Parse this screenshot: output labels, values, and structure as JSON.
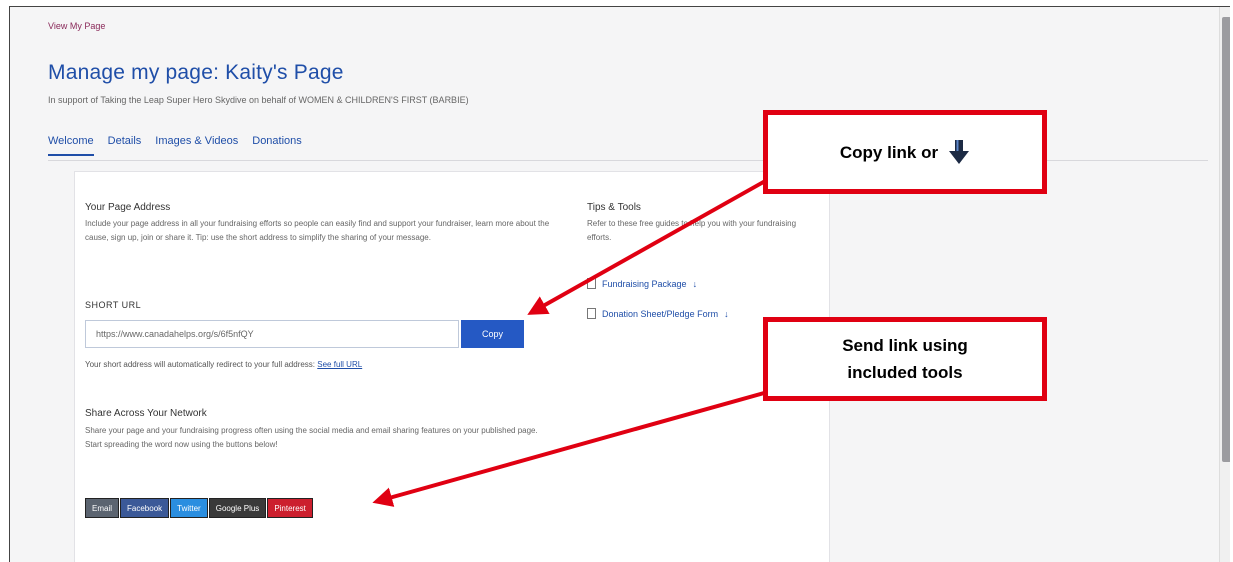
{
  "top_link": "View My Page",
  "page_title": "Manage my page: Kaity's Page",
  "subtitle": "In support of Taking the Leap Super Hero Skydive on behalf of WOMEN & CHILDREN'S FIRST (BARBIE)",
  "tabs": [
    {
      "label": "Welcome",
      "active": true
    },
    {
      "label": "Details",
      "active": false
    },
    {
      "label": "Images & Videos",
      "active": false
    },
    {
      "label": "Donations",
      "active": false
    }
  ],
  "page_address": {
    "title": "Your Page Address",
    "description": "Include your page address in all your fundraising efforts so people can easily find and support your fundraiser, learn more about the cause, sign up, join or share it. Tip: use the short address to simplify the sharing of your message."
  },
  "short_url": {
    "label": "SHORT URL",
    "value": "https://www.canadahelps.org/s/6f5nfQY",
    "copy_label": "Copy",
    "note_prefix": "Your short address will automatically redirect to your full address: ",
    "note_link": "See full URL"
  },
  "share": {
    "title": "Share Across Your Network",
    "description": "Share your page and your fundraising progress often using the social media and email sharing features on your published page. Start spreading the word now using the buttons below!",
    "buttons": [
      {
        "label": "Email",
        "color": "#5b6470"
      },
      {
        "label": "Facebook",
        "color": "#3b5998"
      },
      {
        "label": "Twitter",
        "color": "#2a8ee0"
      },
      {
        "label": "Google Plus",
        "color": "#3a3a3a"
      },
      {
        "label": "Pinterest",
        "color": "#cc1f2e"
      }
    ]
  },
  "tips": {
    "title": "Tips & Tools",
    "description": "Refer to these free guides to help you with your fundraising efforts.",
    "links": [
      {
        "label": "Fundraising Package",
        "icon": "document-icon"
      },
      {
        "label": "Donation Sheet/Pledge Form",
        "icon": "document-icon"
      }
    ]
  },
  "callouts": {
    "copy": "Copy link or",
    "send_line1": "Send link using",
    "send_line2": "included tools"
  },
  "colors": {
    "accent": "#1f4ea8",
    "copy_button": "#2559c4",
    "callout_red": "#e00012"
  }
}
